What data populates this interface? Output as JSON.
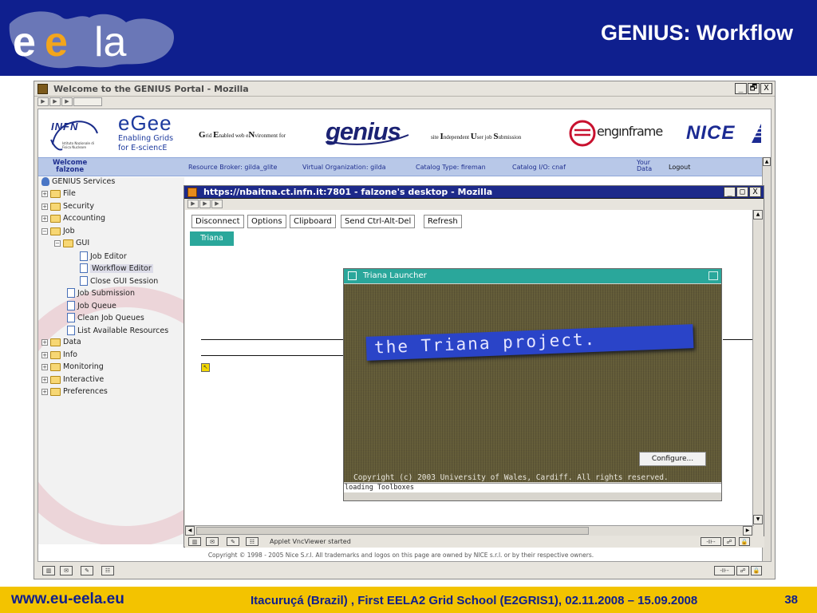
{
  "slide": {
    "title": "GENIUS: Workflow",
    "logo_text": "ee la",
    "footer_url": "www.eu-eela.eu",
    "footer_event": "Itacuruçá (Brazil) , First EELA2 Grid School (E2GRIS1), 02.11.2008 – 15.09.2008",
    "page_number": "38",
    "colors": {
      "header_bg": "#0f1f8e",
      "footer_bg": "#f3c300"
    }
  },
  "outer_window": {
    "title": "Welcome to the GENIUS Portal - Mozilla",
    "buttons": {
      "minimize": "_",
      "maximize": "🗗",
      "close": "X"
    }
  },
  "logos": {
    "infn_name": "INFN",
    "infn_sub": "Istituto Nazionale di Fisica Nucleare",
    "egee_big": "eGee",
    "egee_line1": "Enabling Grids",
    "egee_line2": "for E-sciencE",
    "grid_env": {
      "G": "G",
      "rid": "rid ",
      "E": "E",
      "nabled": "nabled web e",
      "N": "N",
      "vironment": "vironment for"
    },
    "genius": "genius",
    "siu": {
      "pre": "site ",
      "I": "I",
      "ndependent": "ndependent ",
      "U": "U",
      "ser": "ser job ",
      "S": "S",
      "ubmission": "ubmission"
    },
    "enginframe": "engınframe",
    "nice": "NICE"
  },
  "navbar": {
    "welcome": "Welcome",
    "user": "falzone",
    "resource_broker": "Resource Broker: gilda_glite",
    "virtual_org": "Virtual Organization: gilda",
    "catalog_type": "Catalog Type: fireman",
    "catalog_io": "Catalog I/O: cnaf",
    "your": "Your",
    "data": "Data",
    "logout": "Logout"
  },
  "tree": {
    "root": "GENIUS Services",
    "file": "File",
    "security": "Security",
    "accounting": "Accounting",
    "job": "Job",
    "gui": "GUI",
    "job_editor": "Job Editor",
    "workflow_editor": "Workflow Editor",
    "close_gui": "Close GUI Session",
    "job_submission": "Job Submission",
    "job_queue": "Job Queue",
    "clean_job_queues": "Clean Job Queues",
    "list_resources": "List Available Resources",
    "data": "Data",
    "info": "Info",
    "monitoring": "Monitoring",
    "interactive": "Interactive",
    "preferences": "Preferences"
  },
  "copyright": "Copyright © 1998 - 2005 Nice S.r.l. All trademarks and logos on this page are owned by NICE s.r.l. or by their respective owners.",
  "inner_window": {
    "title": "https://nbaitna.ct.infn.it:7801 - falzone's desktop - Mozilla",
    "buttons": {
      "minimize": "_",
      "maximize": "□",
      "close": "X"
    },
    "vnc_buttons": [
      "Disconnect",
      "Options",
      "Clipboard",
      "Send Ctrl-Alt-Del",
      "Refresh"
    ],
    "tab": "Triana",
    "status": "Applet VncViewer started"
  },
  "launcher": {
    "title": "Triana Launcher",
    "banner": "the Triana project.",
    "configure": "Configure...",
    "copyright": "Copyright (c) 2003 University of Wales, Cardiff. All rights reserved.",
    "loading": "loading Toolboxes"
  }
}
